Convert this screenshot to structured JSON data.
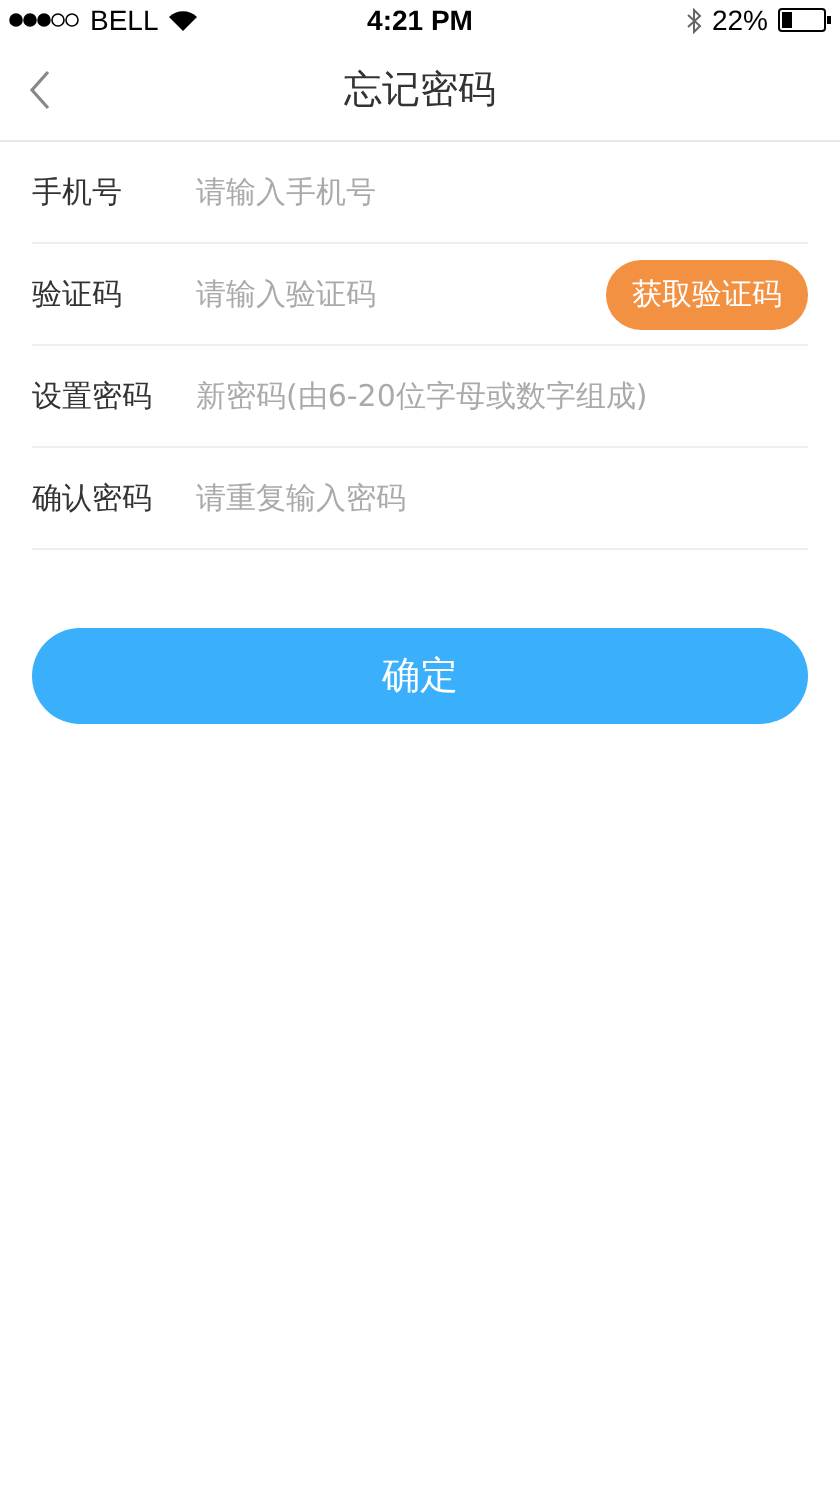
{
  "status_bar": {
    "carrier": "BELL",
    "time": "4:21 PM",
    "battery": "22%"
  },
  "nav": {
    "title": "忘记密码"
  },
  "fields": [
    {
      "label": "手机号",
      "placeholder": "请输入手机号"
    },
    {
      "label": "验证码",
      "placeholder": "请输入验证码",
      "action": "获取验证码"
    },
    {
      "label": "设置密码",
      "placeholder": "新密码(由6-20位字母或数字组成)"
    },
    {
      "label": "确认密码",
      "placeholder": "请重复输入密码"
    }
  ],
  "submit": "确定"
}
